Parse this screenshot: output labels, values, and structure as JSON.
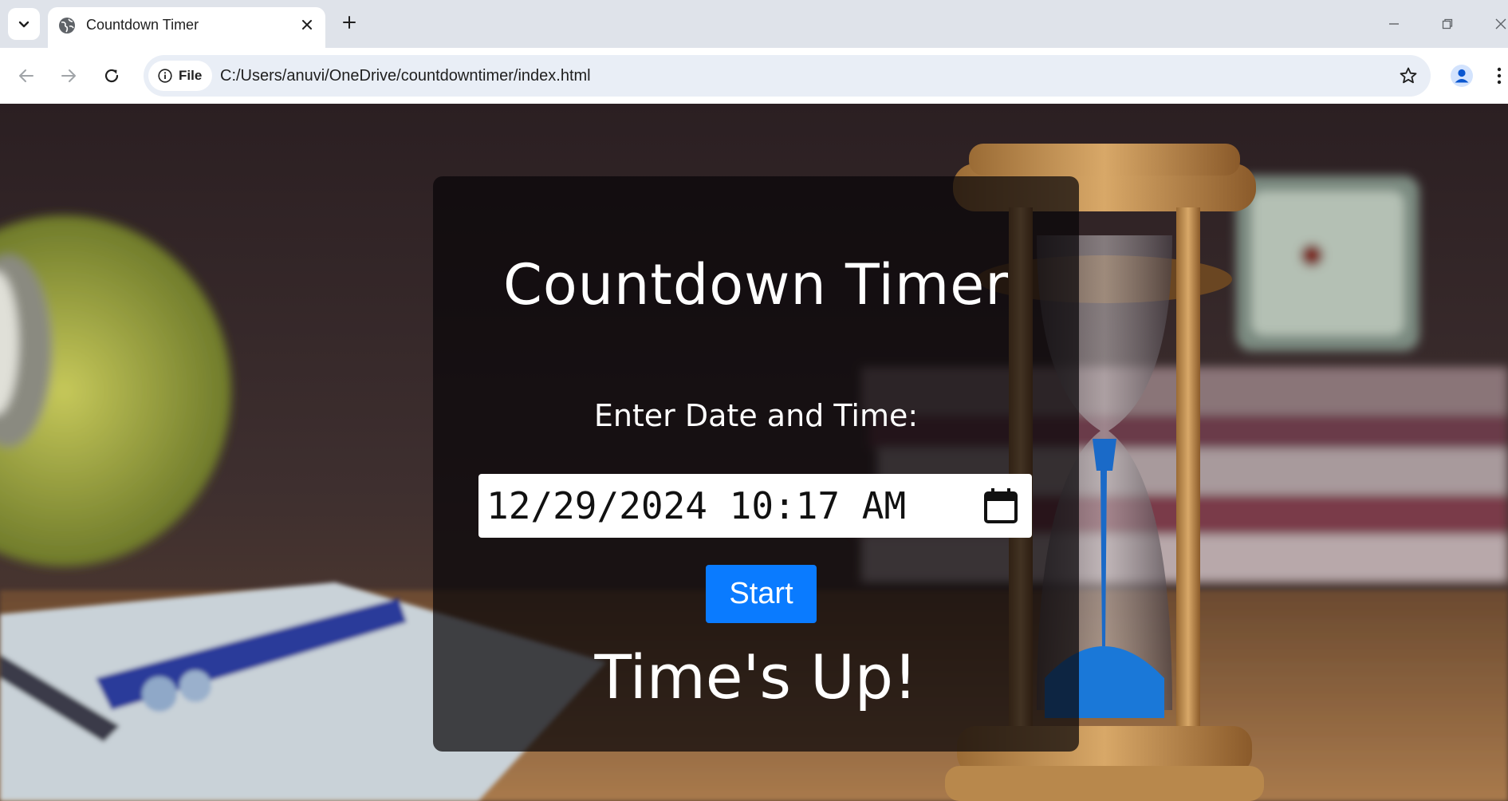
{
  "browser": {
    "tab": {
      "title": "Countdown Timer"
    },
    "address": {
      "chip_label": "File",
      "url": "C:/Users/anuvi/OneDrive/countdowntimer/index.html"
    },
    "icons": {
      "tab_search": "chevron-down-icon",
      "favicon": "globe-icon",
      "tab_close": "close-icon",
      "new_tab": "plus-icon",
      "back": "arrow-left-icon",
      "forward": "arrow-right-icon",
      "reload": "reload-icon",
      "site_info": "info-icon",
      "bookmark": "star-icon",
      "profile": "profile-icon",
      "menu": "more-vertical-icon"
    }
  },
  "page": {
    "title": "Countdown Timer",
    "input_label": "Enter Date and Time:",
    "datetime_value": "12/29/2024 10:17 AM",
    "start_label": "Start",
    "result_text": "Time's Up!",
    "colors": {
      "button": "#0a7bff",
      "card": "rgba(8,6,8,0.72)",
      "text": "#ffffff"
    }
  }
}
